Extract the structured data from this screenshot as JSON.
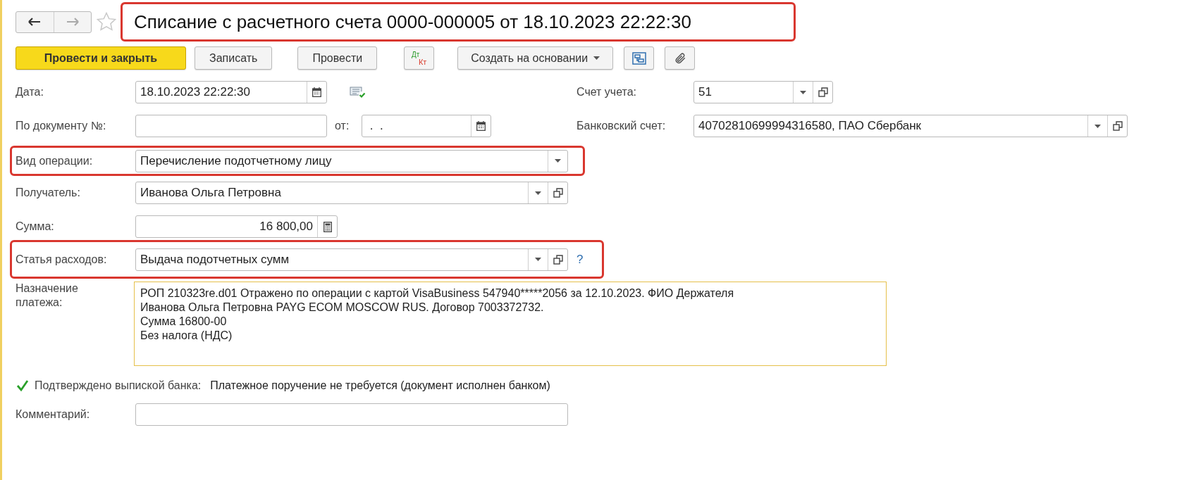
{
  "nav": [
    {
      "kind": "back",
      "disabled": false
    },
    {
      "kind": "forward",
      "disabled": true
    }
  ],
  "favorite": {
    "on": false
  },
  "title": {
    "text": "Списание с расчетного счета 0000-000005 от 18.10.2023 22:22:30",
    "highlighted": true
  },
  "toolbar": [
    {
      "kind": "primary",
      "label": "Провести и закрыть"
    },
    {
      "kind": "button",
      "label": "Записать"
    },
    {
      "kind": "button",
      "label": "Провести"
    },
    {
      "kind": "dtkt",
      "top": "Дт",
      "bottom": "Кт"
    },
    {
      "kind": "menu",
      "label": "Создать на основании"
    },
    {
      "kind": "structure"
    },
    {
      "kind": "attach"
    }
  ],
  "date": {
    "label": "Дата:",
    "value": "18.10.2023 22:22:30"
  },
  "account": {
    "label": "Счет учета:",
    "value": "51"
  },
  "doc_number": {
    "label": "По документу №:"
  },
  "doc_date": {
    "label": "от:",
    "value": " .  ."
  },
  "bank_account": {
    "label": "Банковский счет:",
    "value": "40702810699994316580, ПАО Сбербанк"
  },
  "operation": {
    "label": "Вид операции:",
    "value": "Перечисление подотчетному лицу",
    "highlighted": true
  },
  "recipient": {
    "label": "Получатель:",
    "value": "Иванова Ольга Петровна"
  },
  "amount": {
    "label": "Сумма:",
    "value": "16 800,00"
  },
  "expense": {
    "label": "Статья расходов:",
    "value": "Выдача подотчетных сумм",
    "help": "?",
    "highlighted": true
  },
  "purpose": {
    "label": "Назначение платежа:",
    "lines": [
      "РОП 210323re.d01 Отражено по операции с картой VisaBusiness 547940*****2056 за 12.10.2023. ФИО Держателя",
      "Иванова Ольга Петровна PAYG ECOM MOSCOW RUS. Договор 7003372732.",
      "Сумма 16800-00",
      "Без налога (НДС)"
    ]
  },
  "confirmed": {
    "label": "Подтверждено выпиской банка:",
    "checked": true,
    "note": "Платежное поручение не требуется (документ исполнен банком)"
  },
  "comment": {
    "label": "Комментарий:"
  }
}
